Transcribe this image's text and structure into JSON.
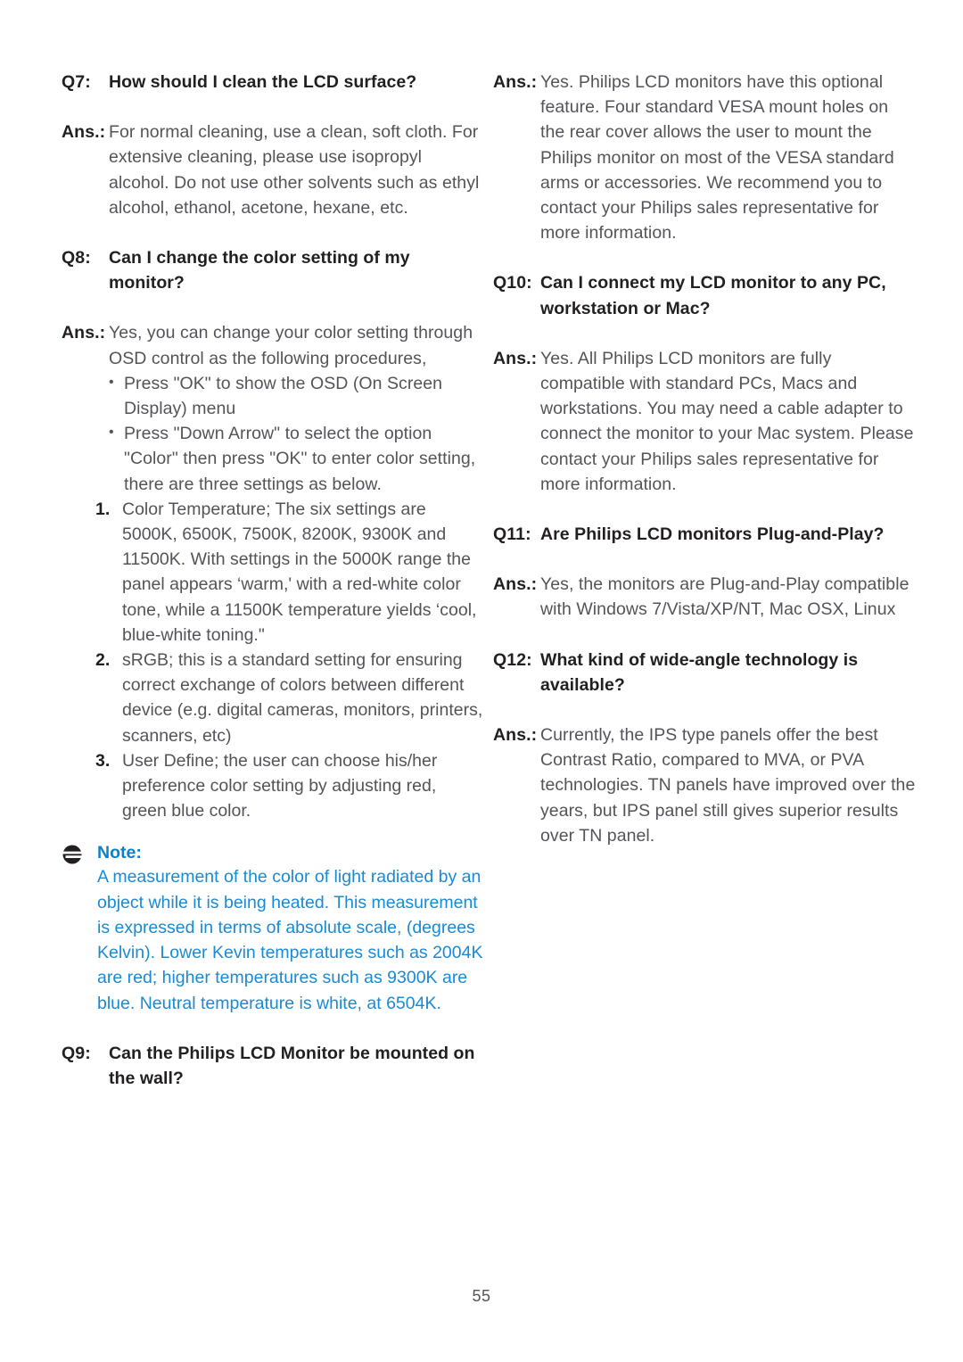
{
  "page": {
    "folio": "55"
  },
  "labels": {
    "q7": "Q7:",
    "q8": "Q8:",
    "q9": "Q9:",
    "q10": "Q10:",
    "q11": "Q11:",
    "q12": "Q12:",
    "ans": "Ans.:"
  },
  "left_column": {
    "q7": {
      "question": "How should I clean the LCD surface?",
      "answer": "For normal cleaning, use a clean, soft cloth. For extensive cleaning, please use isopropyl alcohol. Do not use other solvents such as ethyl alcohol, ethanol, acetone, hexane, etc."
    },
    "q8": {
      "question": "Can I change the color setting of my monitor?",
      "answer_intro": "Yes, you can change your color setting through OSD control as the following procedures,",
      "bullets": [
        "Press \"OK\" to show the OSD (On Screen Display) menu",
        "Press \"Down Arrow\" to select the option \"Color\" then press \"OK\" to enter color setting, there are three settings as below."
      ],
      "numbered": [
        {
          "marker": "1.",
          "text": "Color Temperature; The six settings are 5000K, 6500K, 7500K, 8200K, 9300K and 11500K. With settings in the 5000K range the panel appears ‘warm,' with a red-white color tone, while a 11500K temperature yields ‘cool, blue-white toning.\""
        },
        {
          "marker": "2.",
          "text": "sRGB; this is a standard setting for ensuring correct exchange of colors between different device (e.g. digital cameras, monitors, printers, scanners, etc)"
        },
        {
          "marker": "3.",
          "text": "User Define; the user can choose his/her preference color setting by adjusting red, green blue color."
        }
      ],
      "note": {
        "title": "Note:",
        "text": "A measurement of the color of light radiated by an object while it is being heated. This measurement is expressed in terms of absolute scale, (degrees Kelvin). Lower Kevin temperatures such as 2004K are red; higher temperatures such as 9300K are blue. Neutral temperature is white, at 6504K.",
        "icon": "note-circle-icon",
        "accent_color": "#0d80c8",
        "text_color": "#1a8ad4"
      }
    },
    "q9": {
      "question": "Can the Philips LCD Monitor be  mounted on the wall?"
    }
  },
  "right_column": {
    "q9_answer": {
      "answer": "Yes. Philips LCD monitors have this optional feature. Four standard VESA mount holes on the rear cover allows the user to mount the Philips monitor on most of the VESA standard arms or accessories. We recommend you to contact your Philips sales representative for more information."
    },
    "q10": {
      "question": "Can I connect my LCD monitor to any PC, workstation or Mac?",
      "answer": "Yes. All Philips LCD monitors are fully compatible with standard PCs, Macs and workstations. You may need a cable adapter to connect the monitor to your Mac system. Please contact your Philips sales representative for more information."
    },
    "q11": {
      "question": "Are Philips LCD monitors Plug-and-Play?",
      "answer": "Yes, the monitors are Plug-and-Play compatible with Windows 7/Vista/XP/NT, Mac OSX, Linux"
    },
    "q12": {
      "question": "What kind of wide-angle technology is available?",
      "answer": "Currently, the IPS type panels offer the best Contrast Ratio, compared to MVA, or PVA technologies. TN panels have improved over the years, but IPS panel still gives superior results over TN panel."
    }
  },
  "colors": {
    "heading": "#231f20",
    "body": "#56525a",
    "note_blue": "#1a8ad4",
    "background": "#ffffff"
  }
}
